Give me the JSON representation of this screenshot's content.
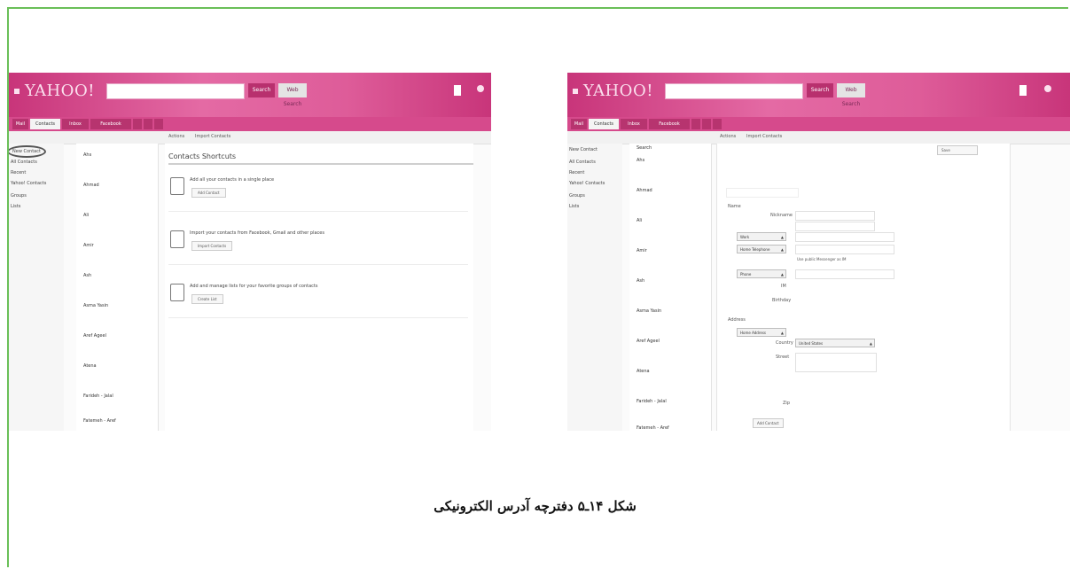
{
  "caption": "شکل ۱۴ـ۵ دفترچه آدرس الکترونیکی",
  "screenshots": [
    {
      "header": {
        "logo": "YAHOO!",
        "search_button": "Search",
        "web_button": "Web Search",
        "user": "",
        "tabs": [
          "Mail",
          "Contacts",
          "Inbox",
          "Facebook",
          "",
          "",
          ""
        ]
      },
      "toolbar": [
        "Actions",
        "Import Contacts"
      ],
      "sidebar": [
        "New Contact",
        "All Contacts",
        "Recent",
        "Yahoo! Contacts",
        "Groups",
        "Lists"
      ],
      "contacts": [
        {
          "name": "Ahs",
          "email": ""
        },
        {
          "name": "Ahmad",
          "email": ""
        },
        {
          "name": "Ali",
          "email": ""
        },
        {
          "name": "Amir",
          "email": ""
        },
        {
          "name": "Ash",
          "email": ""
        },
        {
          "name": "Asma Yasin",
          "email": ""
        },
        {
          "name": "Aref Ageel",
          "email": ""
        },
        {
          "name": "Atena",
          "email": ""
        },
        {
          "name": "Farideh - Jalal",
          "email": ""
        },
        {
          "name": "Fatemeh - Aref",
          "email": ""
        }
      ],
      "pane": {
        "title": "Contacts Shortcuts",
        "tips": [
          {
            "text": "Add all your contacts in a single place",
            "button": "Add Contact"
          },
          {
            "text": "Import your contacts from Facebook, Gmail and other places",
            "button": "Import Contacts"
          },
          {
            "text": "Add and manage lists for your favorite groups of contacts",
            "button": "Create List"
          }
        ]
      }
    },
    {
      "header": {
        "logo": "YAHOO!",
        "search_button": "Search",
        "web_button": "Web Search",
        "user": "",
        "tabs": [
          "Mail",
          "Contacts",
          "Inbox",
          "Facebook",
          "",
          "",
          ""
        ]
      },
      "toolbar": [
        "Actions",
        "Import Contacts"
      ],
      "sidebar": [
        "New Contact",
        "All Contacts",
        "Recent",
        "Yahoo! Contacts",
        "Groups",
        "Lists"
      ],
      "contacts": [
        {
          "name": "Search",
          "email": ""
        },
        {
          "name": "Ahs",
          "email": ""
        },
        {
          "name": "Ahmad",
          "email": ""
        },
        {
          "name": "Ali",
          "email": ""
        },
        {
          "name": "Amir",
          "email": ""
        },
        {
          "name": "Ash",
          "email": ""
        },
        {
          "name": "Asma Yasin",
          "email": ""
        },
        {
          "name": "Aref Ageel",
          "email": ""
        },
        {
          "name": "Atena",
          "email": ""
        },
        {
          "name": "Farideh - Jalal",
          "email": ""
        },
        {
          "name": "Fatemeh - Aref",
          "email": ""
        }
      ],
      "form": {
        "save_button": "Save",
        "name_label": "Name",
        "nickname_label": "Nickname",
        "email_type": "Work",
        "phone_type": "Home Telephone",
        "messenger_type": "Phone",
        "checkbox_label": "Use public Messenger as IM",
        "im_label": "IM",
        "birthday_label": "Birthday",
        "address_section": "Address",
        "address_type": "Home Address",
        "country_label": "Country",
        "country_value": "United States",
        "street_label": "Street",
        "zip_label": "Zip",
        "add_more": "Add Contact"
      }
    }
  ]
}
